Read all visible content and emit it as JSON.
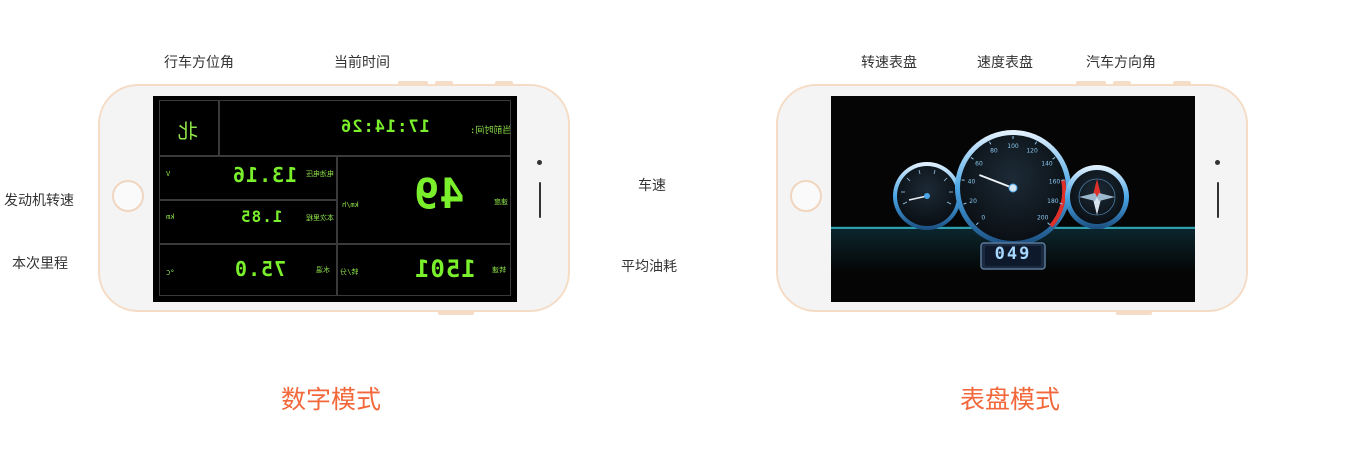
{
  "annotations": {
    "left_top": [
      "行车方位角",
      "当前时间"
    ],
    "left_side": [
      "发动机转速",
      "本次里程"
    ],
    "middle": [
      "车速",
      "平均油耗"
    ],
    "right_top": [
      "转速表盘",
      "速度表盘",
      "汽车方向角"
    ]
  },
  "modes": {
    "digital_title": "数字模式",
    "gauge_title": "表盘模式"
  },
  "digital_screen": {
    "direction": "北",
    "time": "17:14:26",
    "time_label": "当前时间:",
    "rpm_value": "13.16",
    "rpm_label": "电池电压",
    "rpm_unit": "V",
    "mileage_value": "1.85",
    "mileage_label": "本次里程",
    "mileage_unit": "km",
    "temp_value": "75.0",
    "temp_label": "水温",
    "temp_unit": "°C",
    "speed_value": "49",
    "speed_label": "速度",
    "speed_unit": "km/h",
    "rev_value": "1501",
    "rev_label": "转速",
    "rev_unit": "转/分"
  },
  "gauge_screen": {
    "speed_ticks": [
      "0",
      "20",
      "40",
      "60",
      "80",
      "100",
      "120",
      "140",
      "160",
      "180",
      "200"
    ],
    "speed_readout": "049",
    "speed_needle_value": 49,
    "speed_max": 200
  }
}
